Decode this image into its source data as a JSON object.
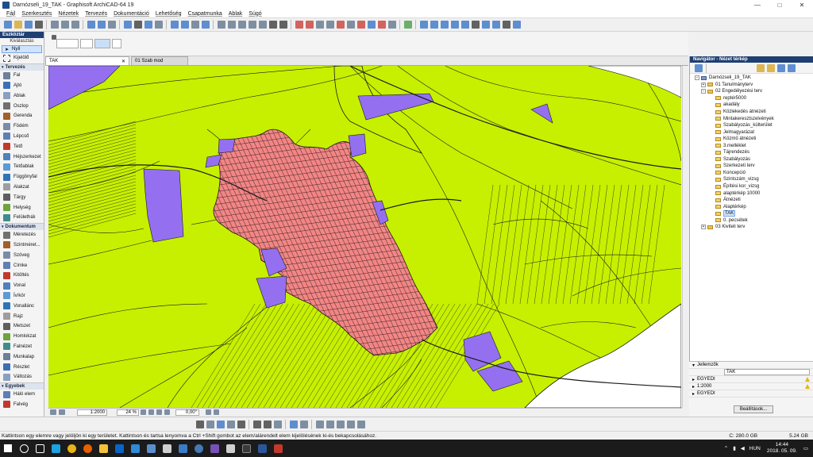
{
  "window": {
    "title": "Darnózseli_19_TAK - Graphisoft ArchiCAD-64 19",
    "controls": [
      "—",
      "□",
      "✕"
    ]
  },
  "menu": [
    "Fájl",
    "Szerkesztés",
    "Nézetek",
    "Tervezés",
    "Dokumentáció",
    "Lehetőség",
    "Csapatmunka",
    "Ablak",
    "Súgó"
  ],
  "toolbox": {
    "title": "Eszköztár",
    "subtitle": "Kiválasztás",
    "selected": "Nyíl",
    "select_tool": "Kijelölő",
    "groups": [
      {
        "name": "Tervezés",
        "tools": [
          "Fal",
          "Ajtó",
          "Ablak",
          "Oszlop",
          "Gerenda",
          "Födém",
          "Lépcső",
          "Tető",
          "Héjszerkezet",
          "Tetőablak",
          "Függönyfal",
          "Alakzat",
          "Tárgy",
          "Helység",
          "Felülethálı"
        ]
      },
      {
        "name": "Dokumentum",
        "tools": [
          "Méretezés",
          "Szintméret...",
          "Szöveg",
          "Címke",
          "Kitöltés",
          "Vonal",
          "Ív/kör",
          "Vonallánc",
          "Rajz",
          "Metszet",
          "Homlokzat",
          "Falnézet",
          "Munkalap",
          "Részlet",
          "Változás"
        ]
      },
      {
        "name": "Egyebek",
        "tools": [
          "Háló elem",
          "Falvég"
        ]
      }
    ]
  },
  "tabs": [
    {
      "label": "TAK",
      "active": true
    },
    {
      "label": "01 Szab mod",
      "active": false
    }
  ],
  "canvas_status": {
    "scale": "1:2000",
    "zoom": "24 %",
    "angle": "0,00°"
  },
  "navigator": {
    "title": "Navigátor - Nézet térkép",
    "root": "Darnózseli_19_TAK",
    "items": [
      {
        "label": "01 Tanulmányterv",
        "level": 1,
        "exp": "+"
      },
      {
        "label": "02 Engedélyezési terv",
        "level": 1,
        "exp": "−"
      },
      {
        "label": "reptér5000",
        "level": 2
      },
      {
        "label": "akadály",
        "level": 2
      },
      {
        "label": "Közlekedés átnézeti",
        "level": 2
      },
      {
        "label": "Mintakeresztszelvények",
        "level": 2
      },
      {
        "label": "Szabályozás_külterület",
        "level": 2
      },
      {
        "label": "Jelmagyarázat",
        "level": 2
      },
      {
        "label": "Közmű átnézeti",
        "level": 2
      },
      {
        "label": "3.melléklet",
        "level": 2
      },
      {
        "label": "Tájrendezés",
        "level": 2
      },
      {
        "label": "Szabályozás",
        "level": 2
      },
      {
        "label": "Szerkezeti terv",
        "level": 2
      },
      {
        "label": "Koncepció",
        "level": 2
      },
      {
        "label": "Szintszám_vizsg",
        "level": 2
      },
      {
        "label": "Építési kor_vizsg",
        "level": 2
      },
      {
        "label": "alaptérkép 10000",
        "level": 2
      },
      {
        "label": "Átnézeti",
        "level": 2
      },
      {
        "label": "Alaptérkép",
        "level": 2
      },
      {
        "label": "TAK",
        "level": 2,
        "selected": true
      },
      {
        "label": "0. pecsétek",
        "level": 2
      },
      {
        "label": "03 Kiviteli terv",
        "level": 1,
        "exp": "+"
      }
    ]
  },
  "properties": {
    "title": "Jellemzők",
    "name_value": "TAK",
    "rows": [
      "EGYEDI",
      "1:2000",
      "EGYEDI"
    ],
    "button": "Beállítások..."
  },
  "status": {
    "hint": "Kattintson egy elemre vagy jelöljön ki egy területet. Kattintson és tartsa lenyomva a Ctrl +Shift gombot az elem/alárendelt elem kijelölésének ki-és bekapcsolásához.",
    "disk_c": "C: 280.0 GB",
    "mem": "5.24 GB"
  },
  "taskbar": {
    "lang": "HUN",
    "time": "14:44",
    "date": "2018. 05. 09."
  },
  "colors": {
    "agri": "#c6f000",
    "urban": "#f28585",
    "special": "#9470f0",
    "chrome": "#f0f0f0",
    "panel_header": "#1f3f72"
  }
}
